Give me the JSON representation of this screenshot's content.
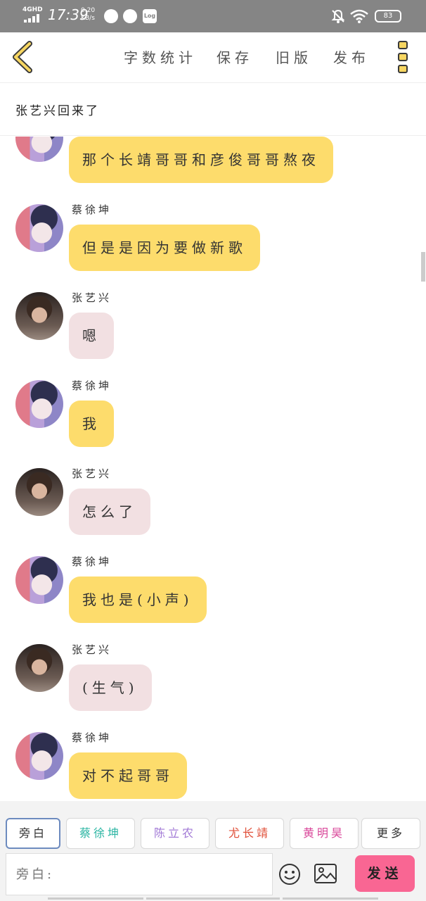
{
  "status_bar": {
    "network": "4GHD",
    "time": "17:39",
    "speed_value": "0.20",
    "speed_unit": "KB/s",
    "log_label": "Log",
    "battery": "83"
  },
  "toolbar": {
    "word_count": "字数统计",
    "save": "保存",
    "old_version": "旧版",
    "publish": "发布"
  },
  "story_title": "张艺兴回来了",
  "messages": [
    {
      "sender": "",
      "text": "那个长靖哥哥和彦俊哥哥熬夜",
      "style": "yellow",
      "avatar": "cai"
    },
    {
      "sender": "蔡徐坤",
      "text": "但是是因为要做新歌",
      "style": "yellow",
      "avatar": "cai"
    },
    {
      "sender": "张艺兴",
      "text": "嗯",
      "style": "pink",
      "avatar": "zhang"
    },
    {
      "sender": "蔡徐坤",
      "text": "我",
      "style": "yellow",
      "avatar": "cai"
    },
    {
      "sender": "张艺兴",
      "text": "怎么了",
      "style": "pink",
      "avatar": "zhang"
    },
    {
      "sender": "蔡徐坤",
      "text": "我也是(小声)",
      "style": "yellow",
      "avatar": "cai"
    },
    {
      "sender": "张艺兴",
      "text": "(生气)",
      "style": "pink",
      "avatar": "zhang"
    },
    {
      "sender": "蔡徐坤",
      "text": "对不起哥哥",
      "style": "yellow",
      "avatar": "cai"
    }
  ],
  "roles": [
    {
      "label": "旁白",
      "color": "#333333"
    },
    {
      "label": "蔡徐坤",
      "color": "#2bb5a3"
    },
    {
      "label": "陈立农",
      "color": "#a27ad6"
    },
    {
      "label": "尤长靖",
      "color": "#e0503a"
    },
    {
      "label": "黄明昊",
      "color": "#d9479a"
    },
    {
      "label": "更多",
      "color": "#333333"
    }
  ],
  "input": {
    "placeholder": "旁白:"
  },
  "send_label": "发送",
  "colors": {
    "accent_yellow": "#fddc6c",
    "bubble_pink": "#f2e0e2",
    "send_pink": "#f96693"
  }
}
